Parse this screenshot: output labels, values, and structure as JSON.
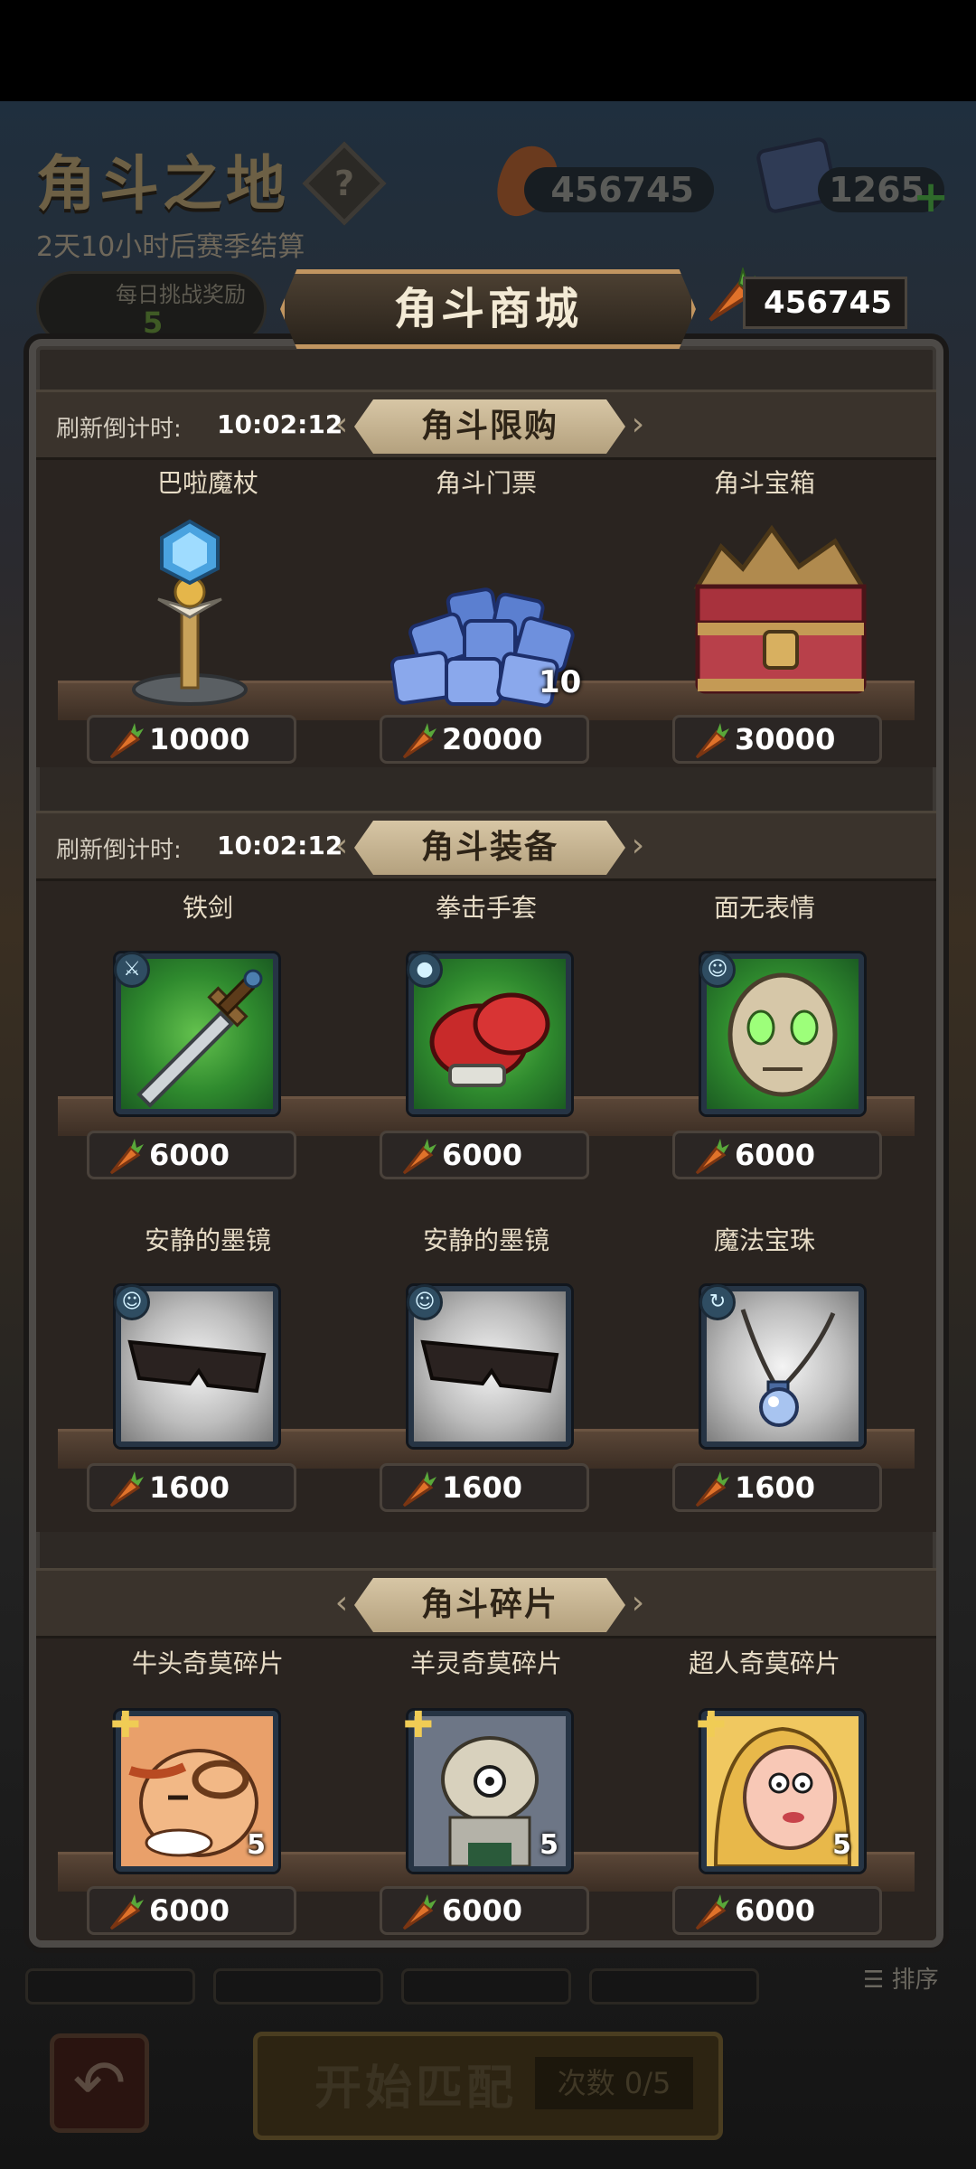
{
  "background": {
    "arena_title": "角斗之地",
    "help_icon": "?",
    "season_countdown": "2天10小时后赛季结算",
    "carrot_balance": "456745",
    "ticket_balance": "1265",
    "daily_reward_label": "每日挑战奖励",
    "daily_reward_count": "5",
    "sort_label": "排序",
    "start_match_label": "开始匹配",
    "attempts_label": "次数 0/5"
  },
  "shop": {
    "title": "角斗商城",
    "carrot_balance": "456745",
    "sections": {
      "limited": {
        "title": "角斗限购",
        "timer_label": "刷新倒计时:",
        "timer_value": "10:02:12",
        "items": [
          {
            "name": "巴啦魔杖",
            "price": "10000",
            "icon": "magic-wand-icon"
          },
          {
            "name": "角斗门票",
            "price": "20000",
            "icon": "arena-tickets-icon",
            "count": "10"
          },
          {
            "name": "角斗宝箱",
            "price": "30000",
            "icon": "treasure-chest-icon"
          }
        ]
      },
      "equipment": {
        "title": "角斗装备",
        "timer_label": "刷新倒计时:",
        "timer_value": "10:02:12",
        "items": [
          {
            "name": "铁剑",
            "price": "6000",
            "icon": "iron-sword-icon"
          },
          {
            "name": "拳击手套",
            "price": "6000",
            "icon": "boxing-glove-icon"
          },
          {
            "name": "面无表情",
            "price": "6000",
            "icon": "blank-mask-icon"
          },
          {
            "name": "安静的墨镜",
            "price": "1600",
            "icon": "sunglasses-icon"
          },
          {
            "name": "安静的墨镜",
            "price": "1600",
            "icon": "sunglasses-icon"
          },
          {
            "name": "魔法宝珠",
            "price": "1600",
            "icon": "magic-orb-necklace-icon"
          }
        ]
      },
      "fragments": {
        "title": "角斗碎片",
        "items": [
          {
            "name": "牛头奇莫碎片",
            "price": "6000",
            "count": "5",
            "icon": "bull-character-icon"
          },
          {
            "name": "羊灵奇莫碎片",
            "price": "6000",
            "count": "5",
            "icon": "goat-skull-character-icon"
          },
          {
            "name": "超人奇莫碎片",
            "price": "6000",
            "count": "5",
            "icon": "blonde-character-icon"
          }
        ]
      }
    }
  },
  "colors": {
    "accent_gold": "#c19560",
    "ribbon": "#d7c6a5",
    "card_green": "#3f9b37",
    "card_gray": "#bdbdbd",
    "carrot": "#e0722a"
  }
}
